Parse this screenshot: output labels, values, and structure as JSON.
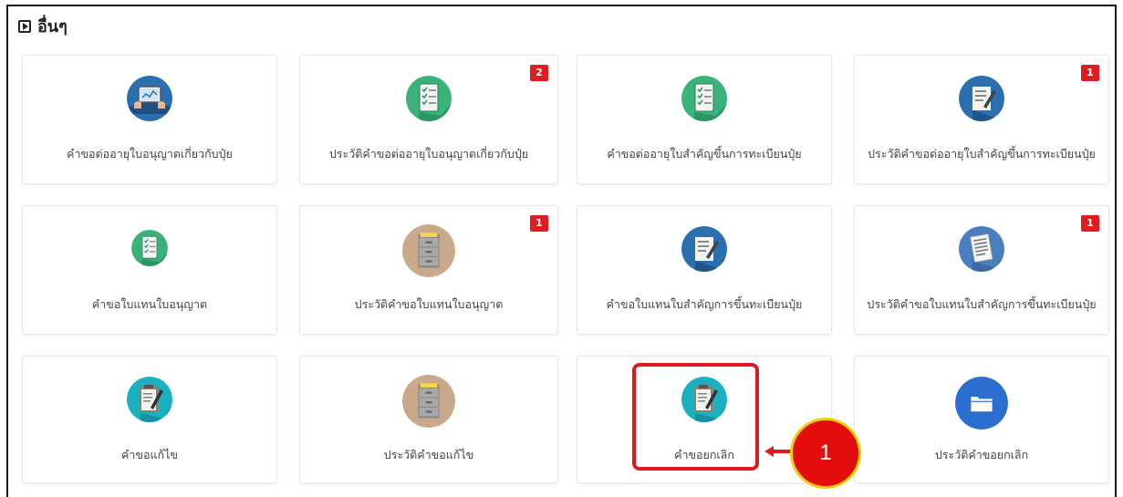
{
  "section": {
    "title": "อื่นๆ"
  },
  "cards": [
    {
      "label": "คำขอต่ออายุใบอนุญาตเกี่ยวกับปุ๋ย",
      "icon": "tablet-hands-icon",
      "badge": ""
    },
    {
      "label": "ประวัติคำขอต่ออายุใบอนุญาตเกี่ยวกับปุ๋ย",
      "icon": "checklist-icon",
      "badge": "2"
    },
    {
      "label": "คำขอต่ออายุใบสำคัญขึ้นการทะเบียนปุ๋ย",
      "icon": "checklist-icon",
      "badge": ""
    },
    {
      "label": "ประวัติคำขอต่ออายุใบสำคัญขึ้นการทะเบียนปุ๋ย",
      "icon": "document-pen-icon",
      "badge": "1"
    },
    {
      "label": "คำขอใบแทนใบอนุญาต",
      "icon": "checklist-icon",
      "badge": ""
    },
    {
      "label": "ประวัติคำขอใบแทนใบอนุญาต",
      "icon": "file-cabinet-icon",
      "badge": "1"
    },
    {
      "label": "คำขอใบแทนใบสำคัญการขึ้นทะเบียนปุ๋ย",
      "icon": "document-pen-icon",
      "badge": ""
    },
    {
      "label": "ประวัติคำขอใบแทนใบสำคัญการขึ้นทะเบียนปุ๋ย",
      "icon": "document-lines-icon",
      "badge": "1"
    },
    {
      "label": "คำขอแก้ไข",
      "icon": "clipboard-pen-icon",
      "badge": ""
    },
    {
      "label": "ประวัติคำขอแก้ไข",
      "icon": "file-cabinet-icon",
      "badge": ""
    },
    {
      "label": "คำขอยกเลิก",
      "icon": "clipboard-pen-icon",
      "badge": ""
    },
    {
      "label": "ประวัติคำขอยกเลิก",
      "icon": "folder-icon",
      "badge": ""
    }
  ],
  "callout": {
    "number": "1"
  },
  "colors": {
    "badge": "#e11b22",
    "highlight": "#e0191f",
    "callout_fill": "#e30d0d",
    "callout_border": "#f0d000",
    "icon_blue": "#2a6fb0",
    "icon_green": "#3ab37a",
    "icon_teal": "#1ab0c0",
    "icon_tan": "#c9a98a",
    "icon_folder_blue": "#2a6fd0"
  }
}
